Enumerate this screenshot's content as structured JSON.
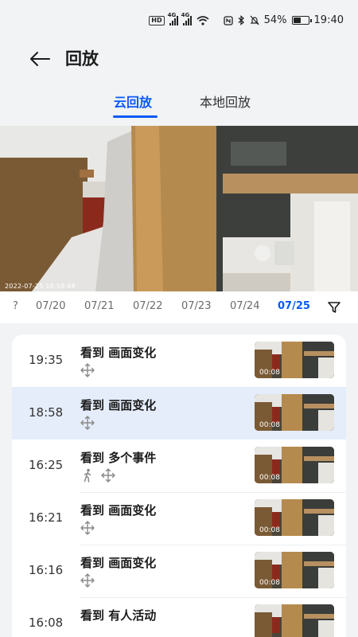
{
  "status": {
    "hd": "HD",
    "sim1": "4G",
    "sim2": "4G",
    "battery": "54%",
    "battery_level": 0.54,
    "time": "19:40"
  },
  "header": {
    "title": "回放"
  },
  "tabs": [
    {
      "label": "云回放",
      "active": true
    },
    {
      "label": "本地回放",
      "active": false
    }
  ],
  "video": {
    "timestamp": "2022-07-25   18:58:48"
  },
  "dates": [
    "?",
    "07/20",
    "07/21",
    "07/22",
    "07/23",
    "07/24",
    "07/25"
  ],
  "active_date": "07/25",
  "events": [
    {
      "time": "19:35",
      "title": "看到 画面变化",
      "icons": [
        "move-icon"
      ],
      "duration": "00:08",
      "selected": false
    },
    {
      "time": "18:58",
      "title": "看到 画面变化",
      "icons": [
        "move-icon"
      ],
      "duration": "00:08",
      "selected": true
    },
    {
      "time": "16:25",
      "title": "看到 多个事件",
      "icons": [
        "person-walk-icon",
        "move-icon"
      ],
      "duration": "00:08",
      "selected": false
    },
    {
      "time": "16:21",
      "title": "看到 画面变化",
      "icons": [
        "move-icon"
      ],
      "duration": "00:08",
      "selected": false
    },
    {
      "time": "16:16",
      "title": "看到 画面变化",
      "icons": [
        "move-icon"
      ],
      "duration": "00:08",
      "selected": false
    },
    {
      "time": "16:08",
      "title": "看到 有人活动",
      "icons": [],
      "duration": "",
      "selected": false
    }
  ],
  "colors": {
    "accent": "#0a59f7",
    "selected_row": "#e5edfb",
    "background": "#f1f3f5"
  }
}
